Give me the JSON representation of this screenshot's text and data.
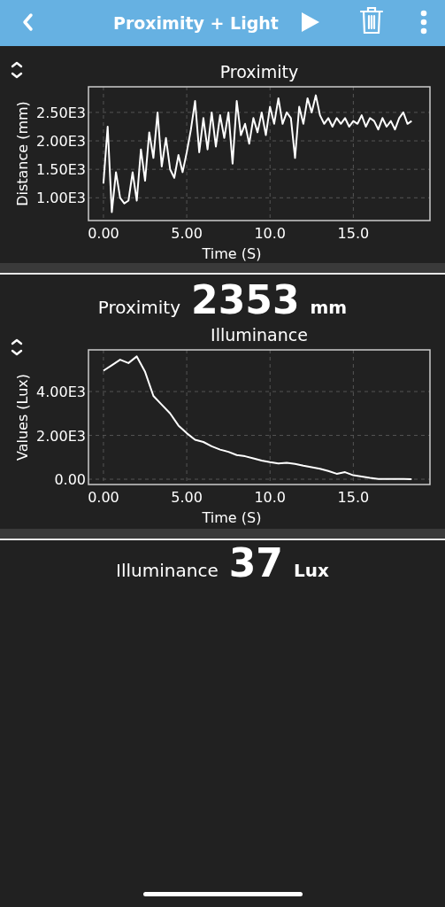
{
  "header": {
    "title": "Proximity + Light"
  },
  "proximity_panel": {
    "chart_data": {
      "type": "line",
      "title": "Proximity",
      "xlabel": "Time (S)",
      "ylabel": "Distance (mm)",
      "xlim": [
        -0.9,
        19.6
      ],
      "ylim": [
        600,
        2950
      ],
      "xticks": [
        {
          "value": 0,
          "label": "0.00"
        },
        {
          "value": 5,
          "label": "5.00"
        },
        {
          "value": 10,
          "label": "10.0"
        },
        {
          "value": 15,
          "label": "15.0"
        }
      ],
      "yticks": [
        {
          "value": 1000,
          "label": "1.00E3"
        },
        {
          "value": 1500,
          "label": "1.50E3"
        },
        {
          "value": 2000,
          "label": "2.00E3"
        },
        {
          "value": 2500,
          "label": "2.50E3"
        }
      ],
      "x": [
        0,
        0.25,
        0.5,
        0.75,
        1,
        1.25,
        1.5,
        1.75,
        2,
        2.25,
        2.5,
        2.75,
        3,
        3.25,
        3.5,
        3.75,
        4,
        4.25,
        4.5,
        4.75,
        5,
        5.25,
        5.5,
        5.75,
        6,
        6.25,
        6.5,
        6.75,
        7,
        7.25,
        7.5,
        7.75,
        8,
        8.25,
        8.5,
        8.75,
        9,
        9.25,
        9.5,
        9.75,
        10,
        10.25,
        10.5,
        10.75,
        11,
        11.25,
        11.5,
        11.75,
        12,
        12.25,
        12.5,
        12.75,
        13,
        13.25,
        13.5,
        13.75,
        14,
        14.25,
        14.5,
        14.75,
        15,
        15.25,
        15.5,
        15.75,
        16,
        16.25,
        16.5,
        16.75,
        17,
        17.25,
        17.5,
        17.75,
        18,
        18.25,
        18.5
      ],
      "grid": true,
      "series": [
        {
          "color": "#ffffff",
          "values": [
            1250,
            2250,
            750,
            1450,
            1000,
            900,
            950,
            1450,
            950,
            1850,
            1300,
            2150,
            1700,
            2500,
            1550,
            2050,
            1500,
            1350,
            1750,
            1450,
            1800,
            2200,
            2700,
            1800,
            2400,
            1850,
            2500,
            1900,
            2450,
            2050,
            2500,
            1600,
            2700,
            2100,
            2300,
            1950,
            2400,
            2150,
            2500,
            2100,
            2600,
            2300,
            2750,
            2300,
            2500,
            2400,
            1700,
            2600,
            2300,
            2750,
            2500,
            2800,
            2450,
            2300,
            2400,
            2250,
            2400,
            2300,
            2400,
            2250,
            2350,
            2300,
            2450,
            2250,
            2400,
            2350,
            2200,
            2400,
            2250,
            2350,
            2200,
            2400,
            2500,
            2300,
            2350
          ]
        }
      ]
    }
  },
  "proximity_reading": {
    "label": "Proximity",
    "value": "2353",
    "unit": "mm"
  },
  "illuminance_panel": {
    "chart_data": {
      "type": "line",
      "title": "Illuminance",
      "xlabel": "Time (S)",
      "ylabel": "Values (Lux)",
      "xlim": [
        -0.9,
        19.6
      ],
      "ylim": [
        -240,
        5900
      ],
      "xticks": [
        {
          "value": 0,
          "label": "0.00"
        },
        {
          "value": 5,
          "label": "5.00"
        },
        {
          "value": 10,
          "label": "10.0"
        },
        {
          "value": 15,
          "label": "15.0"
        }
      ],
      "yticks": [
        {
          "value": 0,
          "label": "0.00"
        },
        {
          "value": 2000,
          "label": "2.00E3"
        },
        {
          "value": 4000,
          "label": "4.00E3"
        }
      ],
      "x": [
        0,
        0.5,
        1,
        1.5,
        2,
        2.5,
        3,
        3.5,
        4,
        4.5,
        5,
        5.5,
        6,
        6.5,
        7,
        7.5,
        8,
        8.5,
        9,
        9.5,
        10,
        10.5,
        11,
        11.5,
        12,
        12.5,
        13,
        13.5,
        14,
        14.5,
        15,
        15.5,
        16,
        16.5,
        17,
        17.5,
        18,
        18.5
      ],
      "grid": true,
      "series": [
        {
          "color": "#ffffff",
          "values": [
            4950,
            5200,
            5450,
            5300,
            5600,
            4900,
            3800,
            3400,
            3000,
            2450,
            2100,
            1800,
            1700,
            1500,
            1350,
            1250,
            1100,
            1050,
            950,
            850,
            780,
            720,
            750,
            700,
            620,
            550,
            480,
            380,
            250,
            320,
            180,
            120,
            60,
            10,
            10,
            10,
            10,
            0
          ]
        }
      ]
    }
  },
  "illuminance_reading": {
    "label": "Illuminance",
    "value": "37",
    "unit": "Lux"
  }
}
